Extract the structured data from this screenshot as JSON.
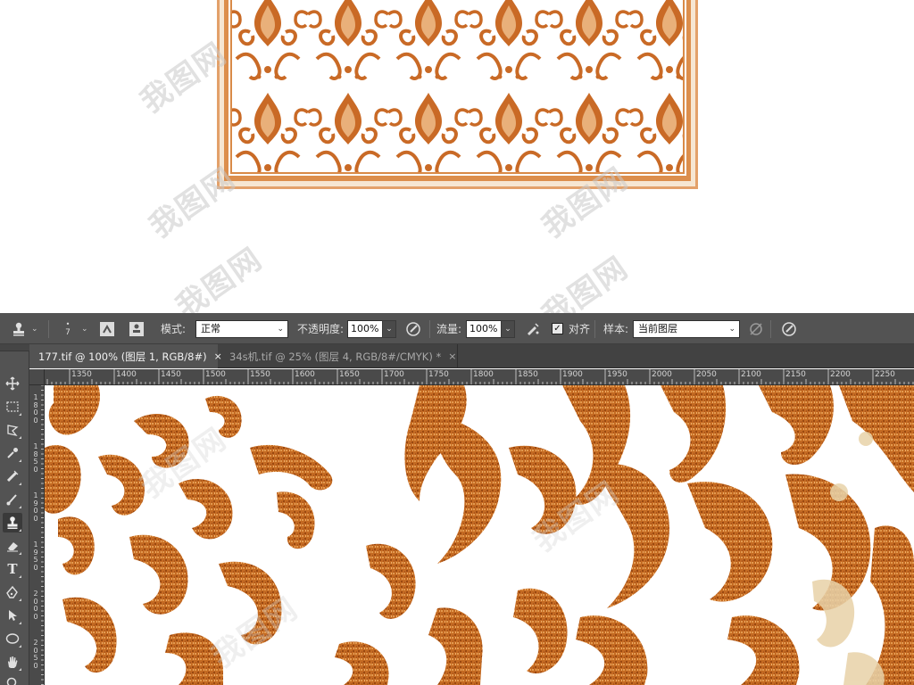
{
  "options_bar": {
    "brush_size": "7",
    "mode_label": "模式:",
    "mode_value": "正常",
    "opacity_label": "不透明度:",
    "opacity_value": "100%",
    "flow_label": "流量:",
    "flow_value": "100%",
    "aligned_label": "对齐",
    "aligned_checked": true,
    "sample_label": "样本:",
    "sample_value": "当前图层"
  },
  "tabs": [
    {
      "label": "177.tif @ 100% (图层 1, RGB/8#)",
      "close": "×",
      "active": true
    },
    {
      "label": "34s机.tif @ 25% (图层 4, RGB/8#/CMYK) *",
      "close": "×",
      "active": false
    }
  ],
  "ruler_h": [
    "1350",
    "1400",
    "1450",
    "1500",
    "1550",
    "1600",
    "1650",
    "1700",
    "1750",
    "1800",
    "1850",
    "1900",
    "1950",
    "2000",
    "2050",
    "2100",
    "2150",
    "2200",
    "2250"
  ],
  "ruler_v": [
    "1800",
    "1850",
    "1900",
    "1950",
    "2000",
    "2050"
  ],
  "tools": [
    {
      "name": "move-tool-icon"
    },
    {
      "name": "marquee-tool-icon"
    },
    {
      "name": "lasso-tool-icon"
    },
    {
      "name": "eyedropper-tool-icon"
    },
    {
      "name": "healing-brush-tool-icon"
    },
    {
      "name": "brush-tool-icon"
    },
    {
      "name": "clone-stamp-tool-icon",
      "selected": true
    },
    {
      "name": "eraser-tool-icon"
    },
    {
      "name": "type-tool-icon"
    },
    {
      "name": "pen-tool-icon"
    },
    {
      "name": "path-selection-tool-icon"
    },
    {
      "name": "ellipse-tool-icon"
    },
    {
      "name": "hand-tool-icon"
    },
    {
      "name": "zoom-tool-icon"
    }
  ],
  "colors": {
    "panel": "#535353",
    "tabbar": "#424242",
    "ruler": "#4a4a4a",
    "pattern_dark": "#b8591a",
    "pattern_mid": "#d4792c",
    "pattern_light": "#e9b07a",
    "carpet_border": "#d98a47"
  }
}
